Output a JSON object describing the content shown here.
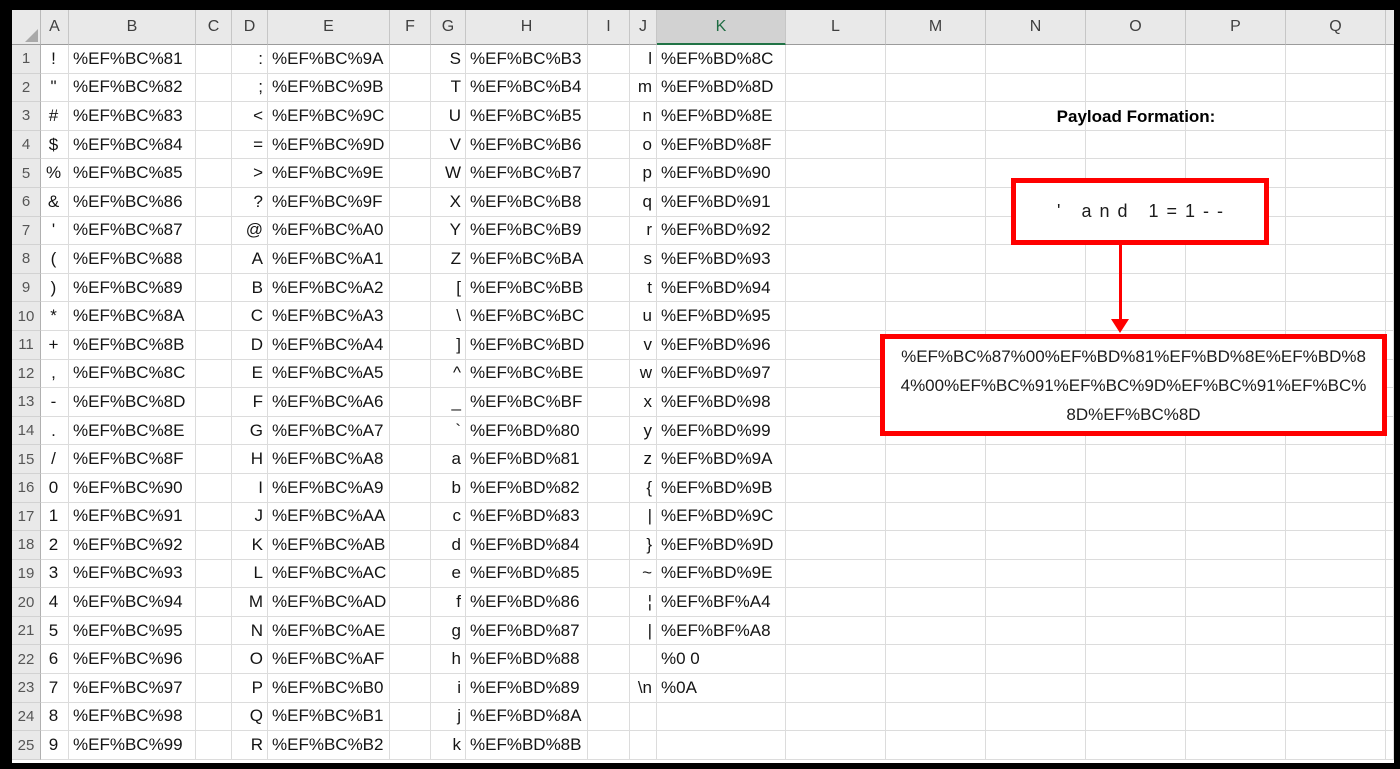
{
  "sheet": {
    "column_headers": [
      "A",
      "B",
      "C",
      "D",
      "E",
      "F",
      "G",
      "H",
      "I",
      "J",
      "K",
      "L",
      "M",
      "N",
      "O",
      "P",
      "Q"
    ],
    "selected_column_header": "K",
    "rows": [
      [
        1,
        "!",
        "%EF%BC%81",
        ":",
        "%EF%BC%9A",
        "S",
        "%EF%BC%B3",
        "l",
        "%EF%BD%8C"
      ],
      [
        2,
        "\"",
        "%EF%BC%82",
        ";",
        "%EF%BC%9B",
        "T",
        "%EF%BC%B4",
        "m",
        "%EF%BD%8D"
      ],
      [
        3,
        "#",
        "%EF%BC%83",
        "<",
        "%EF%BC%9C",
        "U",
        "%EF%BC%B5",
        "n",
        "%EF%BD%8E"
      ],
      [
        4,
        "$",
        "%EF%BC%84",
        "=",
        "%EF%BC%9D",
        "V",
        "%EF%BC%B6",
        "o",
        "%EF%BD%8F"
      ],
      [
        5,
        "%",
        "%EF%BC%85",
        ">",
        "%EF%BC%9E",
        "W",
        "%EF%BC%B7",
        "p",
        "%EF%BD%90"
      ],
      [
        6,
        "&",
        "%EF%BC%86",
        "?",
        "%EF%BC%9F",
        "X",
        "%EF%BC%B8",
        "q",
        "%EF%BD%91"
      ],
      [
        7,
        "'",
        "%EF%BC%87",
        "@",
        "%EF%BC%A0",
        "Y",
        "%EF%BC%B9",
        "r",
        "%EF%BD%92"
      ],
      [
        8,
        "(",
        "%EF%BC%88",
        "A",
        "%EF%BC%A1",
        "Z",
        "%EF%BC%BA",
        "s",
        "%EF%BD%93"
      ],
      [
        9,
        ")",
        "%EF%BC%89",
        "B",
        "%EF%BC%A2",
        "[",
        "%EF%BC%BB",
        "t",
        "%EF%BD%94"
      ],
      [
        10,
        "*",
        "%EF%BC%8A",
        "C",
        "%EF%BC%A3",
        "\\",
        "%EF%BC%BC",
        "u",
        "%EF%BD%95"
      ],
      [
        11,
        "+",
        "%EF%BC%8B",
        "D",
        "%EF%BC%A4",
        "]",
        "%EF%BC%BD",
        "v",
        "%EF%BD%96"
      ],
      [
        12,
        ",",
        "%EF%BC%8C",
        "E",
        "%EF%BC%A5",
        "^",
        "%EF%BC%BE",
        "w",
        "%EF%BD%97"
      ],
      [
        13,
        "-",
        "%EF%BC%8D",
        "F",
        "%EF%BC%A6",
        "_",
        "%EF%BC%BF",
        "x",
        "%EF%BD%98"
      ],
      [
        14,
        ".",
        "%EF%BC%8E",
        "G",
        "%EF%BC%A7",
        "`",
        "%EF%BD%80",
        "y",
        "%EF%BD%99"
      ],
      [
        15,
        "/",
        "%EF%BC%8F",
        "H",
        "%EF%BC%A8",
        "a",
        "%EF%BD%81",
        "z",
        "%EF%BD%9A"
      ],
      [
        16,
        "0",
        "%EF%BC%90",
        "I",
        "%EF%BC%A9",
        "b",
        "%EF%BD%82",
        "{",
        "%EF%BD%9B"
      ],
      [
        17,
        "1",
        "%EF%BC%91",
        "J",
        "%EF%BC%AA",
        "c",
        "%EF%BD%83",
        "|",
        "%EF%BD%9C"
      ],
      [
        18,
        "2",
        "%EF%BC%92",
        "K",
        "%EF%BC%AB",
        "d",
        "%EF%BD%84",
        "}",
        "%EF%BD%9D"
      ],
      [
        19,
        "3",
        "%EF%BC%93",
        "L",
        "%EF%BC%AC",
        "e",
        "%EF%BD%85",
        "~",
        "%EF%BD%9E"
      ],
      [
        20,
        "4",
        "%EF%BC%94",
        "M",
        "%EF%BC%AD",
        "f",
        "%EF%BD%86",
        "¦",
        "%EF%BF%A4"
      ],
      [
        21,
        "5",
        "%EF%BC%95",
        "N",
        "%EF%BC%AE",
        "g",
        "%EF%BD%87",
        "|",
        "%EF%BF%A8"
      ],
      [
        22,
        "6",
        "%EF%BC%96",
        "O",
        "%EF%BC%AF",
        "h",
        "%EF%BD%88",
        "",
        "%0 0"
      ],
      [
        23,
        "7",
        "%EF%BC%97",
        "P",
        "%EF%BC%B0",
        "i",
        "%EF%BD%89",
        "\\n",
        "%0A"
      ],
      [
        24,
        "8",
        "%EF%BC%98",
        "Q",
        "%EF%BC%B1",
        "j",
        "%EF%BD%8A",
        "",
        ""
      ],
      [
        25,
        "9",
        "%EF%BC%99",
        "R",
        "%EF%BC%B2",
        "k",
        "%EF%BD%8B",
        "",
        ""
      ]
    ]
  },
  "annotation": {
    "title": "Payload Formation:",
    "input_text": "' and 1=1--",
    "payload_lines": [
      "%EF%BC%87%00%EF%BD%81%EF%BD%8E%EF%BD%8",
      "4%00%EF%BC%91%EF%BC%9D%EF%BC%91%EF%BC%",
      "8D%EF%BC%8D"
    ],
    "payload_full": "%EF%BC%87%00%EF%BD%81%EF%BD%8E%EF%BD%84%00%EF%BC%91%EF%BC%9D%EF%BC%91%EF%BC%8D%EF%BC%8D",
    "colors": {
      "accent_red": "#FF0000",
      "selected_green": "#217346"
    }
  }
}
